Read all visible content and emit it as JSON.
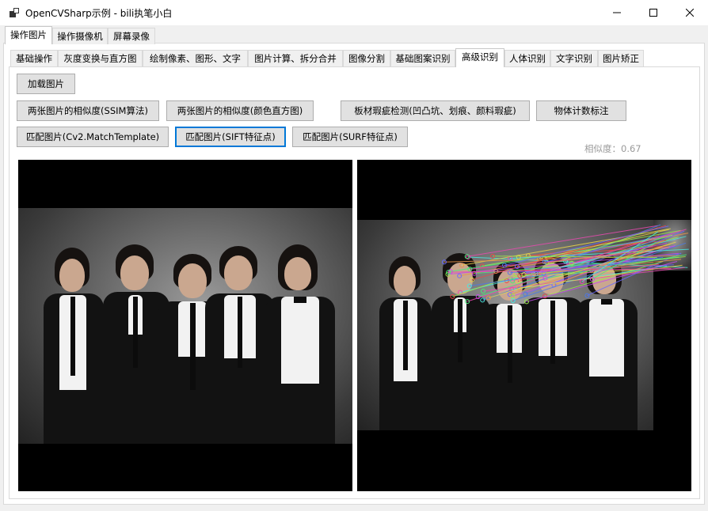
{
  "window": {
    "title": "OpenCVSharp示例 - bili执笔小白",
    "minimize_icon": "minimize-icon",
    "maximize_icon": "maximize-icon",
    "close_icon": "close-icon"
  },
  "main_tabs": [
    {
      "label": "操作图片",
      "active": true
    },
    {
      "label": "操作摄像机",
      "active": false
    },
    {
      "label": "屏幕录像",
      "active": false
    }
  ],
  "sub_tabs": [
    {
      "label": "基础操作",
      "active": false
    },
    {
      "label": "灰度变换与直方图",
      "active": false
    },
    {
      "label": "绘制像素、图形、文字",
      "active": false
    },
    {
      "label": "图片计算、拆分合并",
      "active": false
    },
    {
      "label": "图像分割",
      "active": false
    },
    {
      "label": "基础图案识别",
      "active": false
    },
    {
      "label": "高级识别",
      "active": true
    },
    {
      "label": "人体识别",
      "active": false
    },
    {
      "label": "文字识别",
      "active": false
    },
    {
      "label": "图片矫正",
      "active": false
    }
  ],
  "buttons": {
    "load": "加载图片",
    "ssim": "两张图片的相似度(SSIM算法)",
    "histogram": "两张图片的相似度(颜色直方图)",
    "defect": "板材瑕疵检测(凹凸坑、划痕、颜料瑕疵)",
    "count": "物体计数标注",
    "match_template": "匹配图片(Cv2.MatchTemplate)",
    "match_sift": "匹配图片(SIFT特征点)",
    "match_surf": "匹配图片(SURF特征点)"
  },
  "similarity_text": "相似度：0.67",
  "colors": {
    "focus_border": "#0078d7",
    "button_bg": "#e1e1e1",
    "picture_bg": "#000000"
  }
}
